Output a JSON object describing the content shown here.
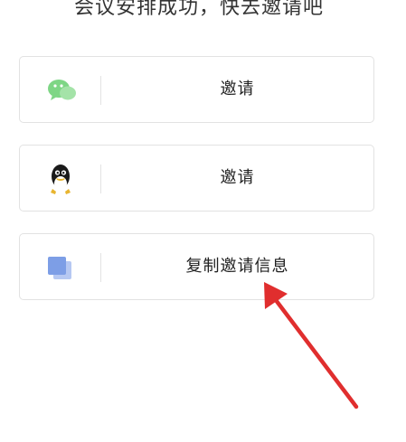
{
  "header": {
    "title": "会议安排成功，快去邀请吧"
  },
  "options": [
    {
      "label": "邀请",
      "icon": "wechat-icon"
    },
    {
      "label": "邀请",
      "icon": "qq-icon"
    },
    {
      "label": "复制邀请信息",
      "icon": "copy-icon"
    }
  ],
  "colors": {
    "wechat_green": "#7ed685",
    "copy_blue": "#7d9ee6",
    "annotation_red": "#e02e2e",
    "border": "#e2e2e2"
  },
  "annotation": {
    "type": "arrow",
    "target": "copy-invite-info-button"
  }
}
